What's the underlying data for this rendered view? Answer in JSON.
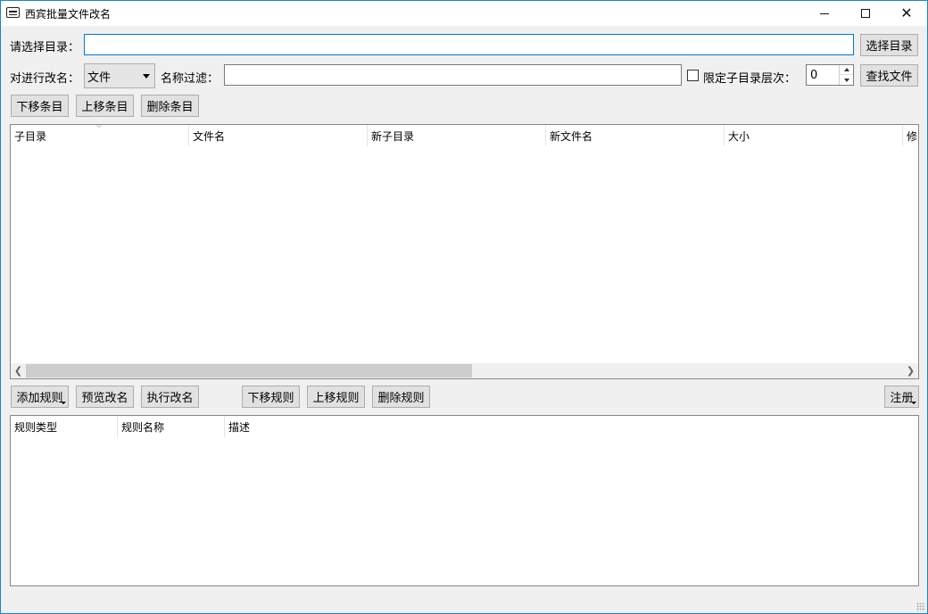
{
  "window": {
    "title": "西宾批量文件改名",
    "min_label": "",
    "max_label": "",
    "close_label": "✕"
  },
  "dir_row": {
    "label": "请选择目录：",
    "dir_value": "",
    "choose_button": "选择目录"
  },
  "filter_row": {
    "target_label": "对进行改名：",
    "target_selected": "文件",
    "name_filter_label": "名称过滤：",
    "name_filter_value": "",
    "limit_depth_label": "限定子目录层次：",
    "limit_depth_checked": false,
    "depth_value": "0",
    "find_button": "查找文件"
  },
  "item_buttons": {
    "move_down": "下移条目",
    "move_up": "上移条目",
    "delete": "删除条目"
  },
  "file_list": {
    "columns": [
      "子目录",
      "文件名",
      "新子目录",
      "新文件名",
      "大小",
      "修改"
    ],
    "rows": []
  },
  "rule_buttons": {
    "add_rule": "添加规则",
    "preview": "预览改名",
    "execute": "执行改名",
    "move_down": "下移规则",
    "move_up": "上移规则",
    "delete": "删除规则",
    "register": "注册"
  },
  "rule_list": {
    "columns": [
      "规则类型",
      "规则名称",
      "描述"
    ],
    "rows": []
  }
}
